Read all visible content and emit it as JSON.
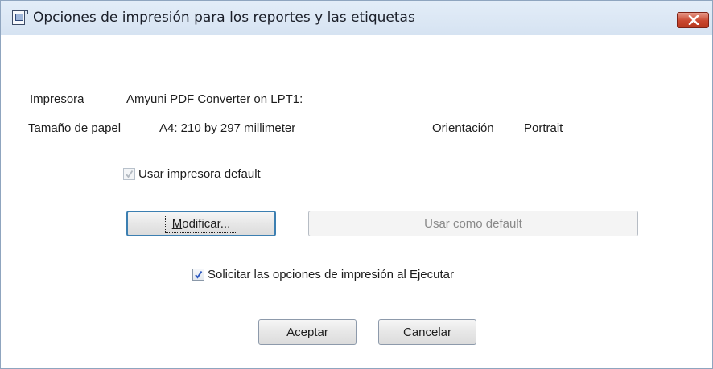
{
  "window": {
    "title": "Opciones de impresión para los reportes y las etiquetas",
    "close_icon": "close-icon"
  },
  "printer": {
    "label": "Impresora",
    "value": "Amyuni PDF Converter on LPT1:"
  },
  "paper": {
    "label": "Tamaño de papel",
    "value": "A4: 210 by 297 millimeter"
  },
  "orientation": {
    "label": "Orientación",
    "value": "Portrait"
  },
  "use_default_printer": {
    "label": "Usar impresora default",
    "checked": true,
    "enabled": false
  },
  "buttons": {
    "modify_prefix": "M",
    "modify_rest": "odificar...",
    "set_default": "Usar como default",
    "accept": "Aceptar",
    "cancel": "Cancelar"
  },
  "prompt_options": {
    "label": "Solicitar las opciones de impresión al Ejecutar",
    "checked": true
  },
  "colors": {
    "accent": "#3c7fb1",
    "close_red": "#c9472f"
  }
}
